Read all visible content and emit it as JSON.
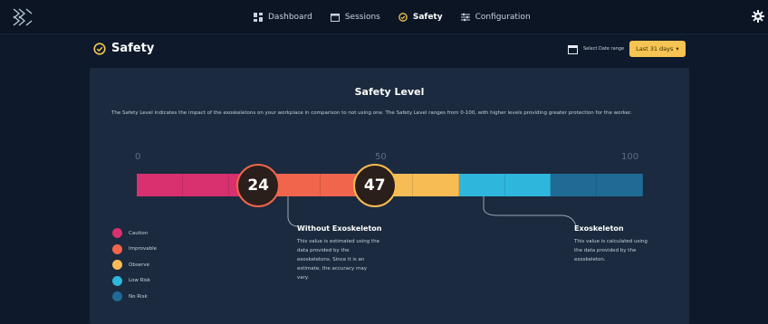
{
  "nav": {
    "items": [
      {
        "label": "Dashboard",
        "icon": "dashboard-icon"
      },
      {
        "label": "Sessions",
        "icon": "calendar-icon"
      },
      {
        "label": "Safety",
        "icon": "safety-icon",
        "active": true
      },
      {
        "label": "Configuration",
        "icon": "sliders-icon"
      }
    ],
    "settings_icon": "gear-icon"
  },
  "header": {
    "title": "Safety",
    "date_range_label": "Select Date range",
    "date_range_value": "Last 31 days"
  },
  "card": {
    "title": "Safety Level",
    "description": "The Safety Level indicates the impact of the exoskeletons on your workplace in comparison to not using one. The Safety Level ranges from 0-100, with higher levels providing greater protection for the worker."
  },
  "scale": {
    "ticks": [
      "0",
      "50",
      "100"
    ],
    "min": 0,
    "max": 100,
    "segments": [
      {
        "color": "#d9306f"
      },
      {
        "color": "#d9306f"
      },
      {
        "color": "#d9306f"
      },
      {
        "color": "#f0654c"
      },
      {
        "color": "#f0654c"
      },
      {
        "color": "#f8bc55"
      },
      {
        "color": "#f8bc55"
      },
      {
        "color": "#2eb6dd"
      },
      {
        "color": "#2eb6dd"
      },
      {
        "color": "#1f6b96"
      },
      {
        "color": "#1f6b96"
      }
    ],
    "without_value": 24,
    "with_value": 47,
    "without_ring_color": "#f0654c",
    "with_ring_color": "#f8bc55"
  },
  "legend": [
    {
      "label": "Caution",
      "color": "#d9306f"
    },
    {
      "label": "Improvable",
      "color": "#f0654c"
    },
    {
      "label": "Observe",
      "color": "#f8bc55"
    },
    {
      "label": "Low Risk",
      "color": "#2eb6dd"
    },
    {
      "label": "No Risk",
      "color": "#1f6b96"
    }
  ],
  "annotations": {
    "without": {
      "title": "Without Exoskeleton",
      "lines": [
        "This value is estimated using the",
        "data provided by the",
        "exoskeletons. Since it is an",
        "estimate, the accuracy may",
        "vary."
      ]
    },
    "with": {
      "title": "Exoskeleton",
      "lines": [
        "This value is calculated using",
        "the data provided by the",
        "exoskeleton."
      ]
    }
  }
}
